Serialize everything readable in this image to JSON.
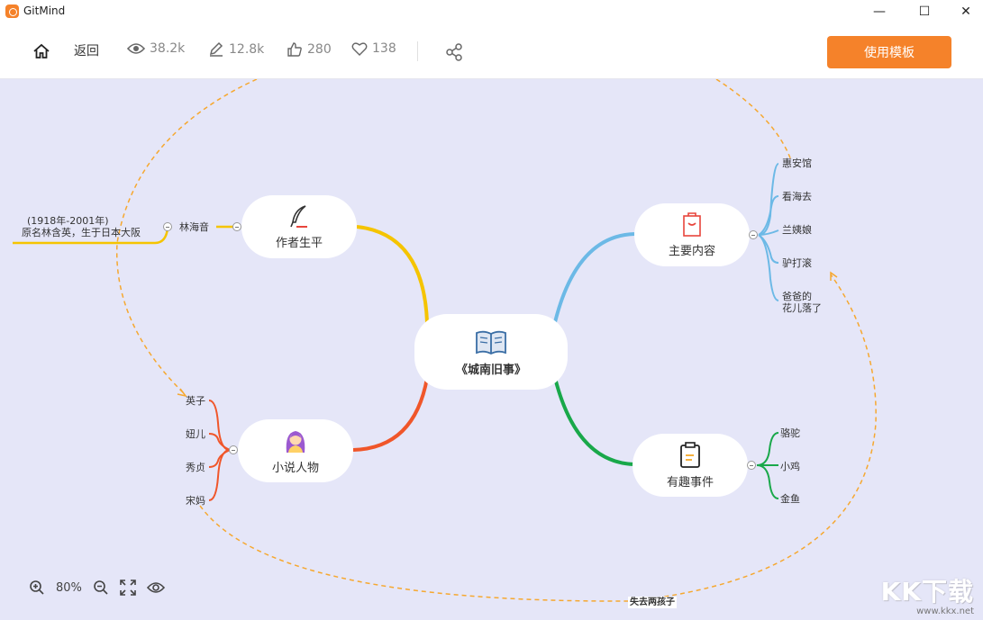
{
  "app": {
    "title": "GitMind"
  },
  "window": {
    "minimize": "—",
    "maximize": "☐",
    "close": "✕"
  },
  "toolbar": {
    "back_label": "返回",
    "views": "38.2k",
    "edits": "12.8k",
    "likes": "280",
    "favorites": "138",
    "use_template_label": "使用模板"
  },
  "mindmap": {
    "center": "《城南旧事》",
    "author": {
      "label": "作者生平",
      "child": "林海音",
      "detail_line1": "(1918年-2001年)",
      "detail_line2": "原名林含英，生于日本大阪"
    },
    "content": {
      "label": "主要内容",
      "items": [
        "惠安馆",
        "看海去",
        "兰姨娘",
        "驴打滚",
        "爸爸的",
        "花儿落了"
      ]
    },
    "characters": {
      "label": "小说人物",
      "items": [
        "英子",
        "妞儿",
        "秀贞",
        "宋妈"
      ]
    },
    "events": {
      "label": "有趣事件",
      "items": [
        "骆驼",
        "小鸡",
        "金鱼"
      ]
    },
    "relation_label": "失去两孩子"
  },
  "zoom": {
    "level": "80%"
  },
  "watermark": {
    "big": "KK下载",
    "small": "www.kkx.net"
  },
  "colors": {
    "accent": "#f5822a",
    "canvas": "#e5e6f8",
    "author_branch": "#f5c400",
    "content_branch": "#6cb9e6",
    "characters_branch": "#f0562a",
    "events_branch": "#19a84a",
    "relation": "#f6a830"
  },
  "icons": [
    "home-icon",
    "eye-icon",
    "edit-icon",
    "thumbs-up-icon",
    "heart-icon",
    "share-icon",
    "zoom-in-icon",
    "zoom-out-icon",
    "fit-screen-icon",
    "preview-eye-icon",
    "quill-icon",
    "bag-icon",
    "book-icon",
    "girl-avatar-icon",
    "clipboard-icon"
  ]
}
